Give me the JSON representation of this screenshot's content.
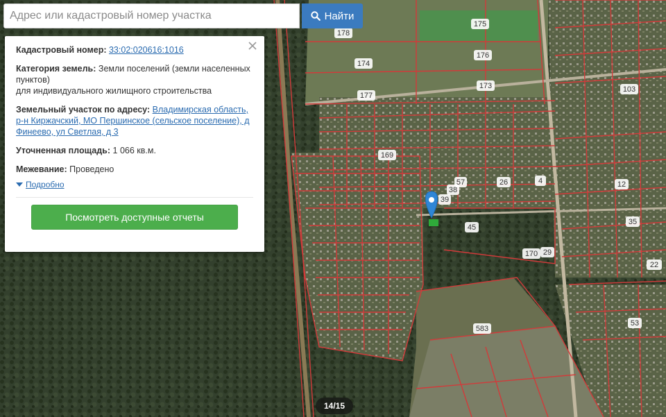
{
  "search": {
    "placeholder": "Адрес или кадастровый номер участка",
    "button_label": "Найти"
  },
  "card": {
    "cadastral_label": "Кадастровый номер:",
    "cadastral_value": "33:02:020616:1016",
    "category_label": "Категория земель:",
    "category_value": "Земли поселений (земли населенных пунктов)",
    "category_use": "для индивидуального жилищного строительства",
    "address_label": "Земельный участок по адресу:",
    "address_value": "Владимирская область, р-н Киржачский, МО Першинское (сельское поселение), д Финеево, ул Светлая, д 3",
    "area_label": "Уточненная площадь:",
    "area_value": "1 066 кв.м.",
    "survey_label": "Межевание:",
    "survey_value": "Проведено",
    "more_label": "Подробно",
    "report_button_label": "Посмотреть доступные отчеты"
  },
  "map": {
    "plot_labels": [
      {
        "text": "178"
      },
      {
        "text": "175"
      },
      {
        "text": "174"
      },
      {
        "text": "176"
      },
      {
        "text": "177"
      },
      {
        "text": "173"
      },
      {
        "text": "103"
      },
      {
        "text": "169"
      },
      {
        "text": "26"
      },
      {
        "text": "4"
      },
      {
        "text": "12"
      },
      {
        "text": "39"
      },
      {
        "text": "38"
      },
      {
        "text": "57"
      },
      {
        "text": "45"
      },
      {
        "text": "35"
      },
      {
        "text": "170"
      },
      {
        "text": "29"
      },
      {
        "text": "22"
      },
      {
        "text": "583"
      },
      {
        "text": "53"
      }
    ]
  },
  "gallery": {
    "counter": "14/15"
  },
  "colors": {
    "accent_blue": "#3b7bbf",
    "button_green": "#4cae4c",
    "boundary_red": "#d23a3a",
    "marker_blue": "#2f86d6"
  }
}
